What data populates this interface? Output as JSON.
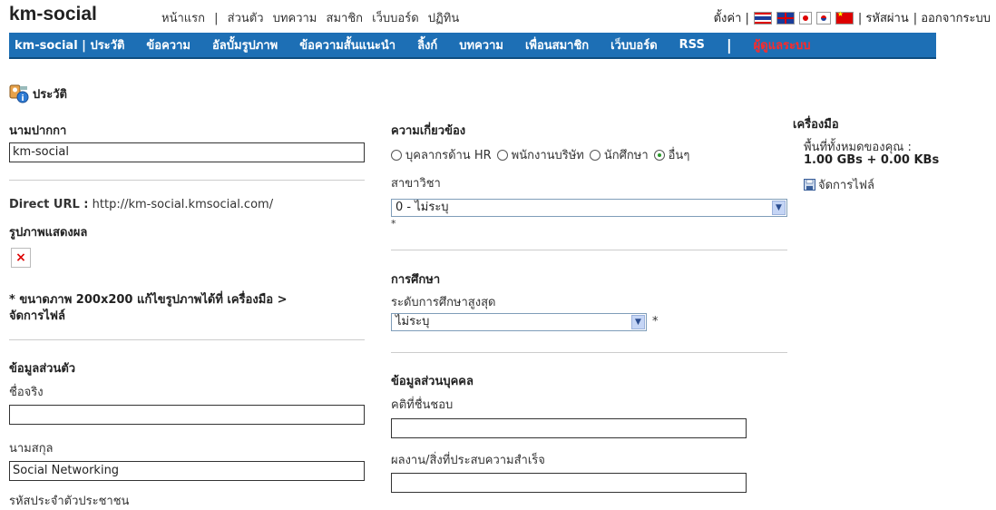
{
  "site": {
    "logo": "km-social"
  },
  "topnav": {
    "items": [
      "หน้าแรก",
      "|",
      "ส่วนตัว",
      "บทความ",
      "สมาชิก",
      "เว็บบอร์ด",
      "ปฏิทิน"
    ]
  },
  "topright": {
    "settings": "ตั้งค่า |",
    "password": "| รหัสผ่าน",
    "logout": "| ออกจากระบบ"
  },
  "navbar": {
    "items": [
      "km-social | ประวัติ",
      "ข้อความ",
      "อัลบั้มรูปภาพ",
      "ข้อความสั้นแนะนำ",
      "ลิ้งก์",
      "บทความ",
      "เพื่อนสมาชิก",
      "เว็บบอร์ด",
      "RSS"
    ],
    "separator": "|",
    "admin": "ผู้ดูแลระบบ",
    "color": "#1d6fb5",
    "admin_color": "#ff2a2a"
  },
  "page": {
    "title": "ประวัติ",
    "icon": "profile-info-icon"
  },
  "left": {
    "penname_label": "นามปากกา",
    "penname_value": "km-social",
    "direct_url_label": "Direct URL :",
    "direct_url_value": "http://km-social.kmsocial.com/",
    "display_image_label": "รูปภาพแสดงผล",
    "image_note": "* ขนาดภาพ 200x200 แก้ไขรูปภาพได้ที่ เครื่องมือ >",
    "image_note_2": "จัดการไฟล์",
    "personal_header": "ข้อมูลส่วนตัว",
    "firstname_label": "ชื่อจริง",
    "firstname_value": "",
    "lastname_label": "นามสกุล",
    "lastname_value": "Social Networking",
    "idcard_label": "รหัสประจำตัวประชาชน"
  },
  "middle": {
    "relation_header": "ความเกี่ยวข้อง",
    "radio_options": [
      "บุคลากรด้าน HR",
      "พนักงานบริษัท",
      "นักศึกษา",
      "อื่นๆ"
    ],
    "radio_selected": "อื่นๆ",
    "field_label": "สาขาวิชา",
    "field_value": "0 - ไม่ระบุ",
    "required": "*",
    "education_header": "การศึกษา",
    "edu_level_label": "ระดับการศึกษาสูงสุด",
    "edu_level_value": "ไม่ระบุ",
    "individual_header": "ข้อมูลส่วนบุคคล",
    "motto_label": "คติที่ชื่นชอบ",
    "motto_value": "",
    "achievement_label": "ผลงาน/สิ่งที่ประสบความสำเร็จ",
    "achievement_value": ""
  },
  "tools": {
    "header": "เครื่องมือ",
    "space_label": "พื้นที่ทั้งหมดของคุณ :",
    "space_value": "1.00 GBs + 0.00 KBs",
    "manage_files": "จัดการไฟล์"
  }
}
